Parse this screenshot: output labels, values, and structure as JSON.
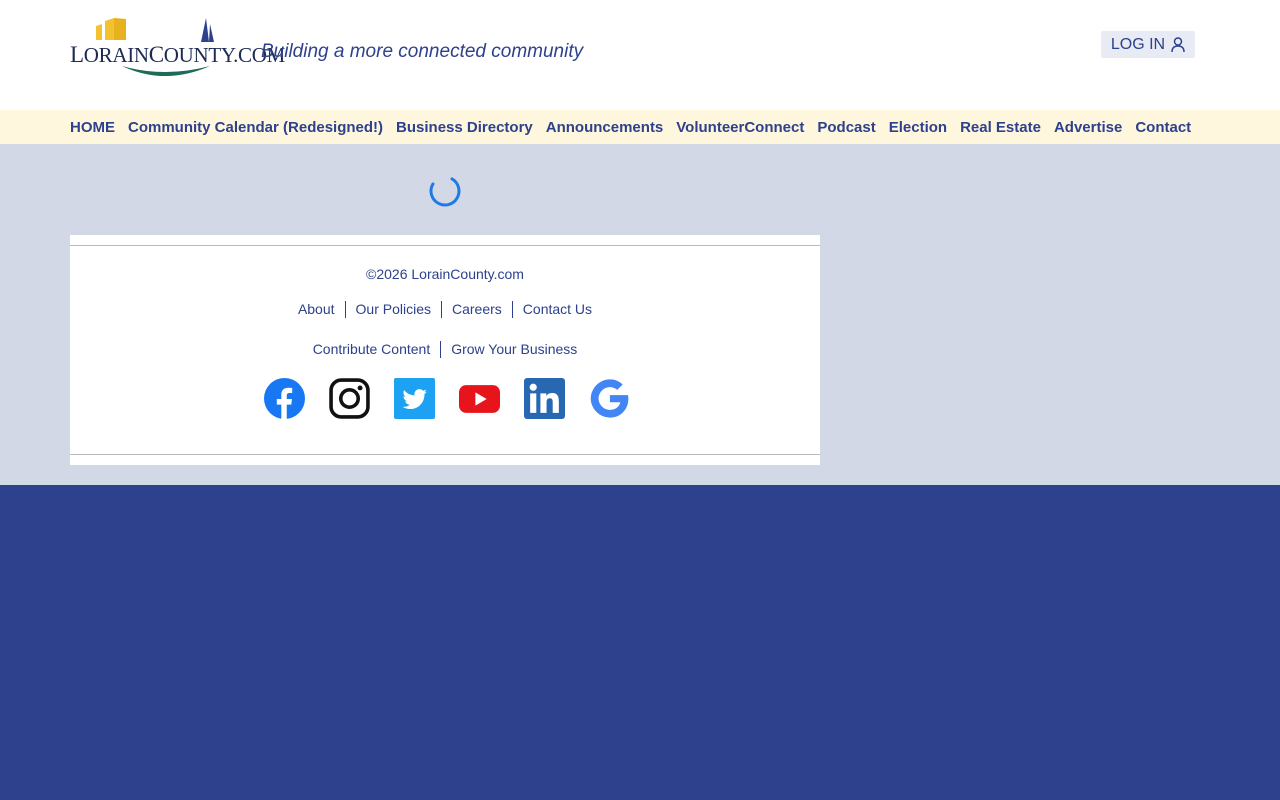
{
  "header": {
    "logo_text_part1": "L",
    "logo_text_part2": "ORAIN",
    "logo_text_part3": "C",
    "logo_text_part4": "OUNTY.COM",
    "tagline": "Building a more connected community",
    "login_label": "LOG IN"
  },
  "nav": {
    "items": [
      {
        "label": "HOME"
      },
      {
        "label": "Community Calendar (Redesigned!)"
      },
      {
        "label": "Business Directory"
      },
      {
        "label": "Announcements"
      },
      {
        "label": "VolunteerConnect"
      },
      {
        "label": "Podcast"
      },
      {
        "label": "Election"
      },
      {
        "label": "Real Estate"
      },
      {
        "label": "Advertise"
      },
      {
        "label": "Contact"
      }
    ]
  },
  "footer": {
    "copyright": "©2026 LorainCounty.com",
    "links_row1": [
      {
        "label": "About"
      },
      {
        "label": "Our Policies"
      },
      {
        "label": "Careers"
      },
      {
        "label": "Contact Us"
      }
    ],
    "links_row2": [
      {
        "label": "Contribute Content"
      },
      {
        "label": "Grow Your Business"
      }
    ],
    "social": [
      "facebook-icon",
      "instagram-icon",
      "twitter-icon",
      "youtube-icon",
      "linkedin-icon",
      "google-icon"
    ]
  },
  "colors": {
    "brand_blue": "#2d418c",
    "nav_bg": "#fff6de",
    "content_bg": "#d3d8e6",
    "spinner": "#1e7be6",
    "facebook": "#1877f2",
    "twitter": "#1da1f2",
    "youtube": "#e8141c",
    "linkedin": "#2867b2",
    "google": "#4285f4"
  }
}
